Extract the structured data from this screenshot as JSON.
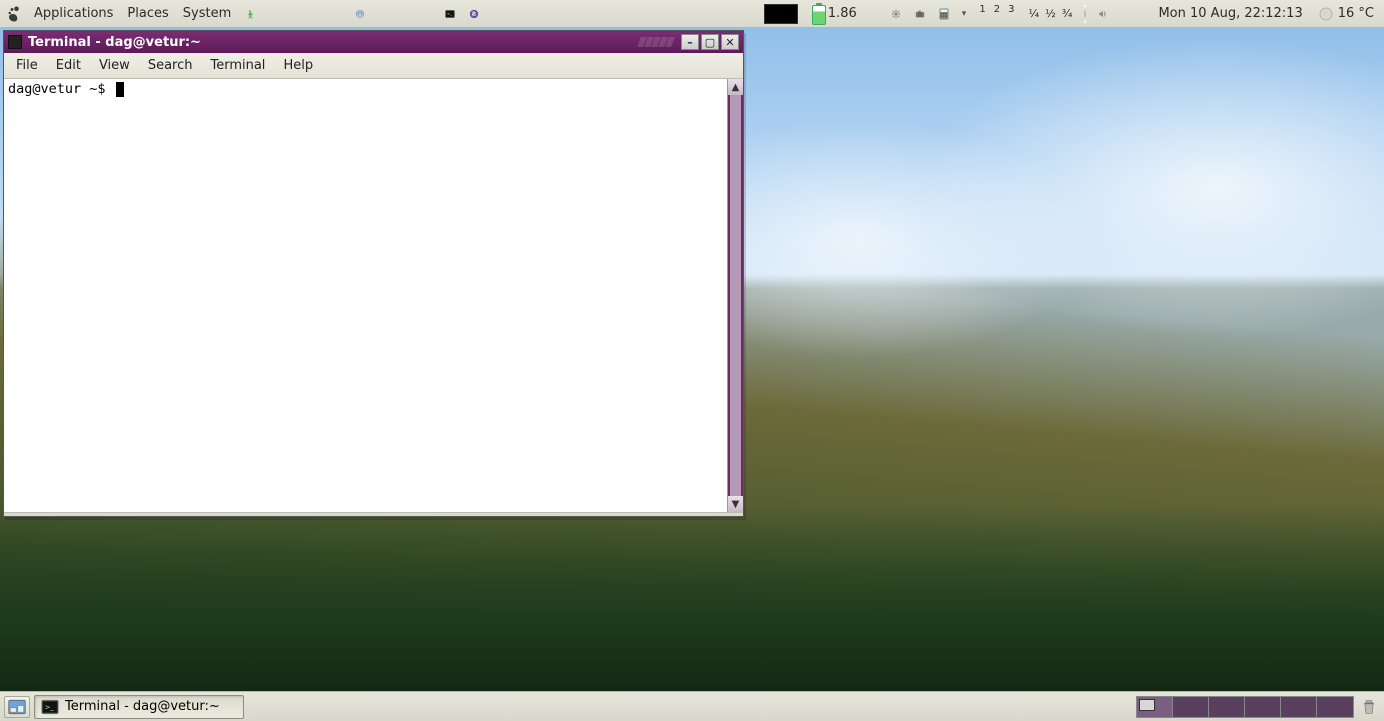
{
  "top_panel": {
    "menus": {
      "applications": "Applications",
      "places": "Places",
      "system": "System"
    },
    "battery_value": "1.86",
    "superscripts": [
      "1",
      "2",
      "3"
    ],
    "fractions": [
      "¼",
      "½",
      "¾"
    ],
    "clock": "Mon 10 Aug, 22:12:13",
    "weather": "16 °C"
  },
  "terminal_window": {
    "title": "Terminal - dag@vetur:~",
    "menus": {
      "file": "File",
      "edit": "Edit",
      "view": "View",
      "search": "Search",
      "terminal": "Terminal",
      "help": "Help"
    },
    "prompt": "dag@vetur ~$ "
  },
  "bottom_panel": {
    "task_label": "Terminal - dag@vetur:~",
    "workspaces": 6,
    "current_workspace": 0
  }
}
